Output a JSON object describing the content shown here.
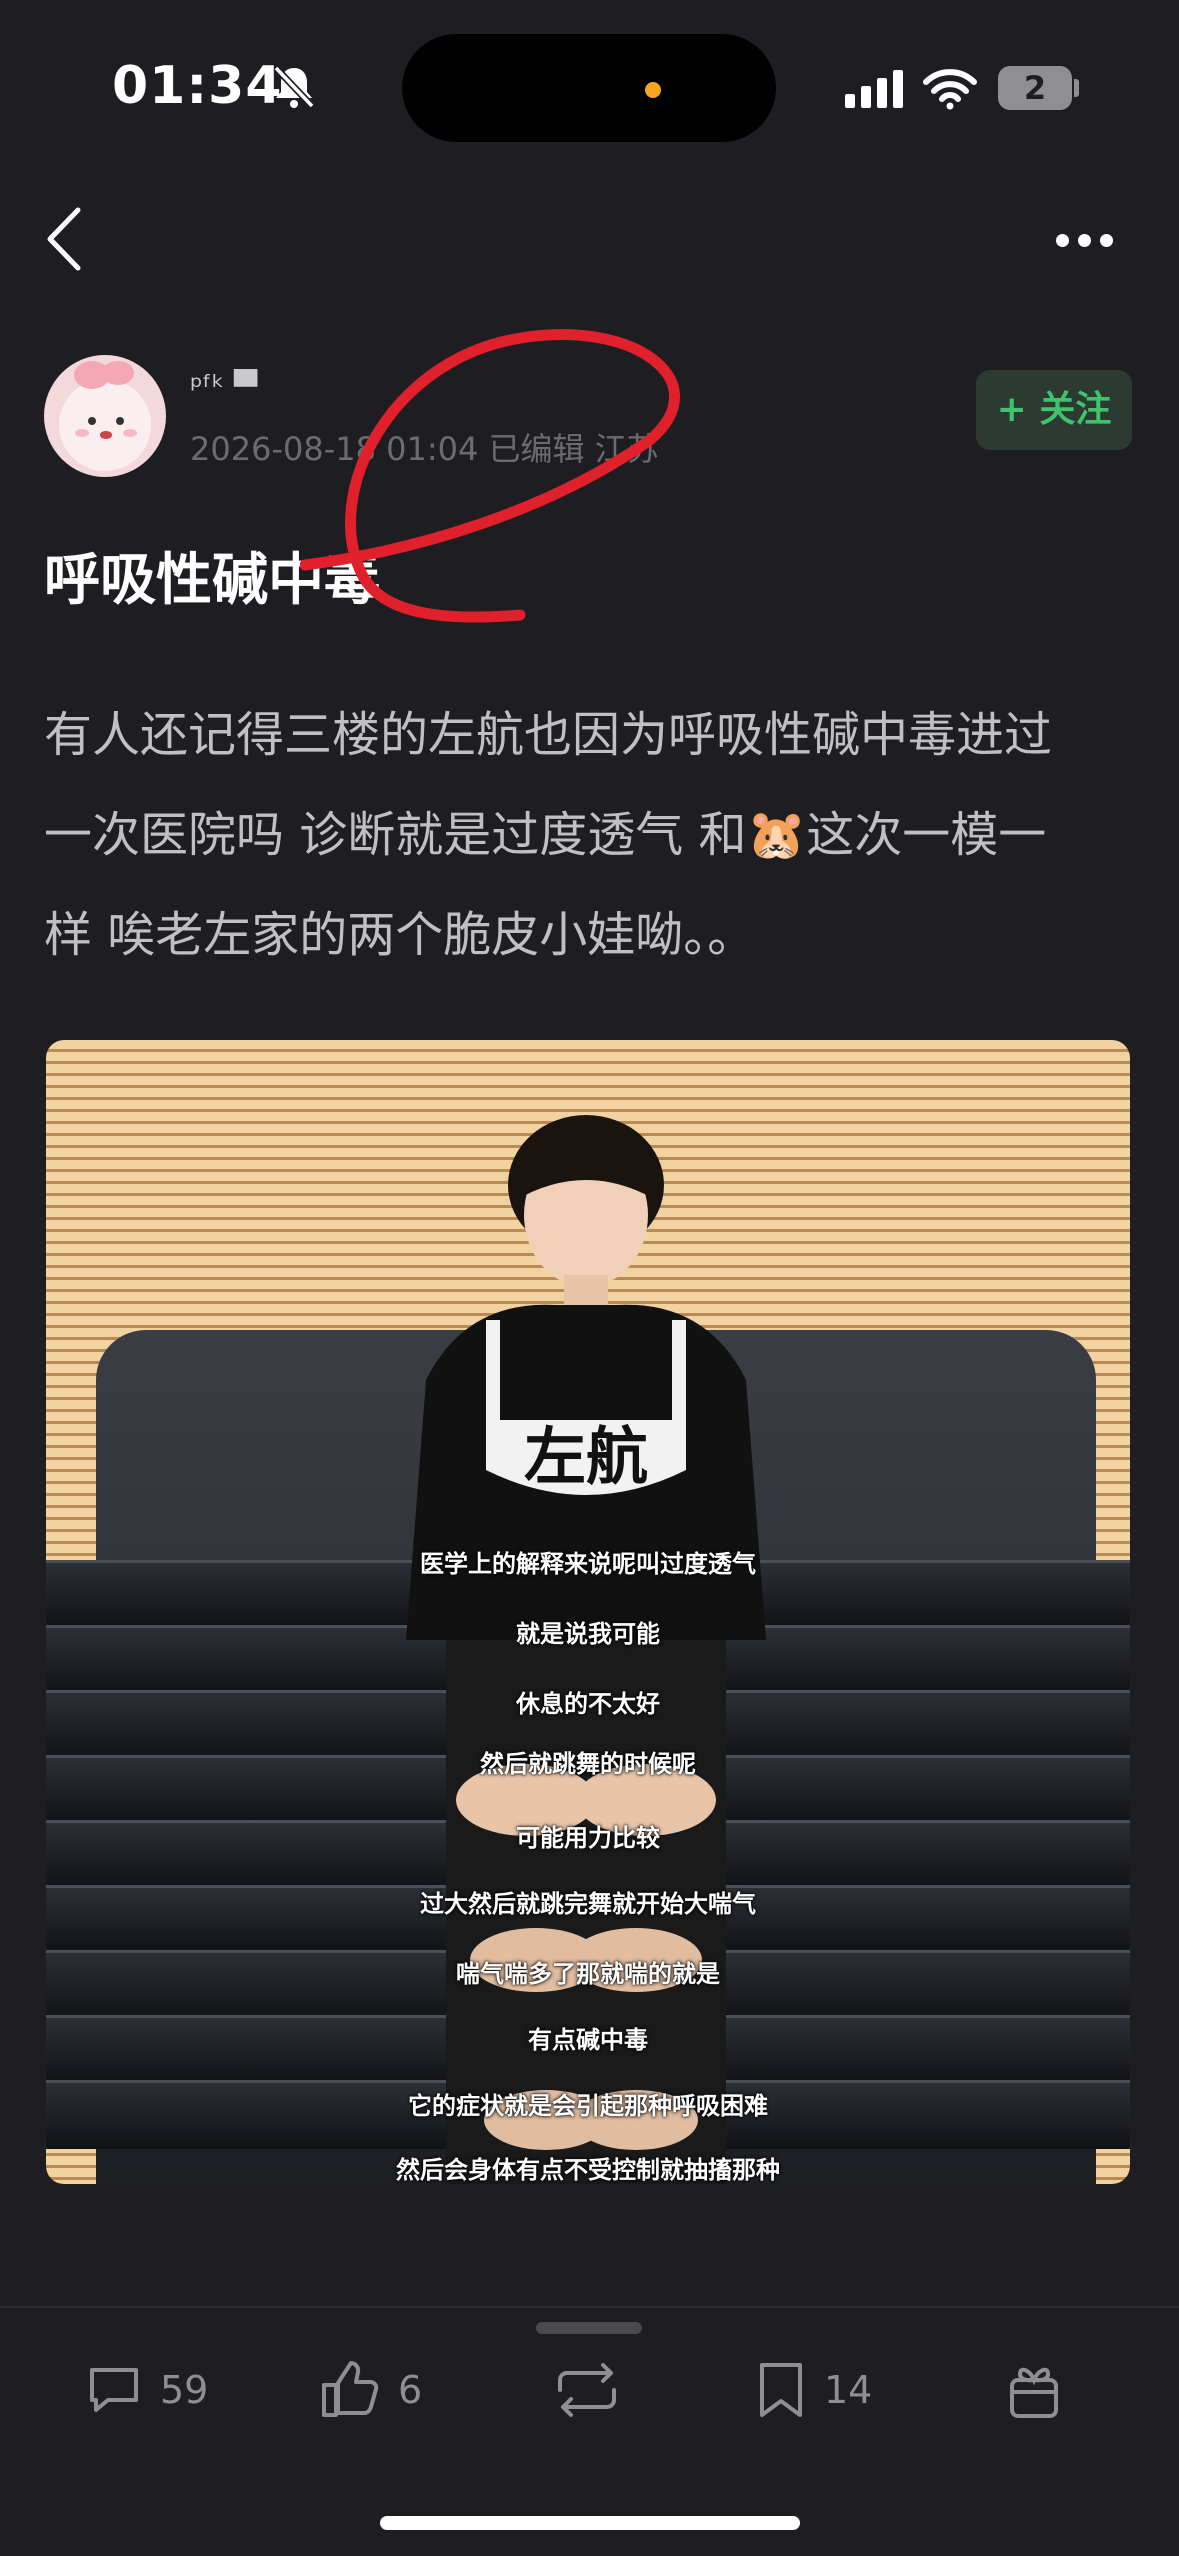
{
  "status_bar": {
    "time": "01:34",
    "battery": "2"
  },
  "post": {
    "author": {
      "name": "ᵖᶠᵏ ▀"
    },
    "meta": "2026-08-18 01:04  已编辑  江苏",
    "follow_label": "+ 关注",
    "title": "呼吸性碱中毒",
    "body_lines": [
      "有人还记得三楼的左航也因为呼吸性碱中毒进过",
      "一次医院吗 诊断就是过度透气 和🐹这次一模一",
      "样 唉老左家的两个脆皮小娃呦。。"
    ]
  },
  "image": {
    "shirt_text": "左航",
    "subtitles": [
      "医学上的解释来说呢叫过度透气",
      "就是说我可能",
      "休息的不太好",
      "然后就跳舞的时候呢",
      "可能用力比较",
      "过大然后就跳完舞就开始大喘气",
      "喘气喘多了那就喘的就是",
      "有点碱中毒",
      "它的症状就是会引起那种呼吸困难",
      "然后会身体有点不受控制就抽搐那种"
    ]
  },
  "actions": {
    "comments": "59",
    "likes": "6",
    "saves": "14"
  },
  "colors": {
    "background": "#1e1e22",
    "accent_green": "#3ec46d",
    "annotation_red": "#e0202a"
  }
}
